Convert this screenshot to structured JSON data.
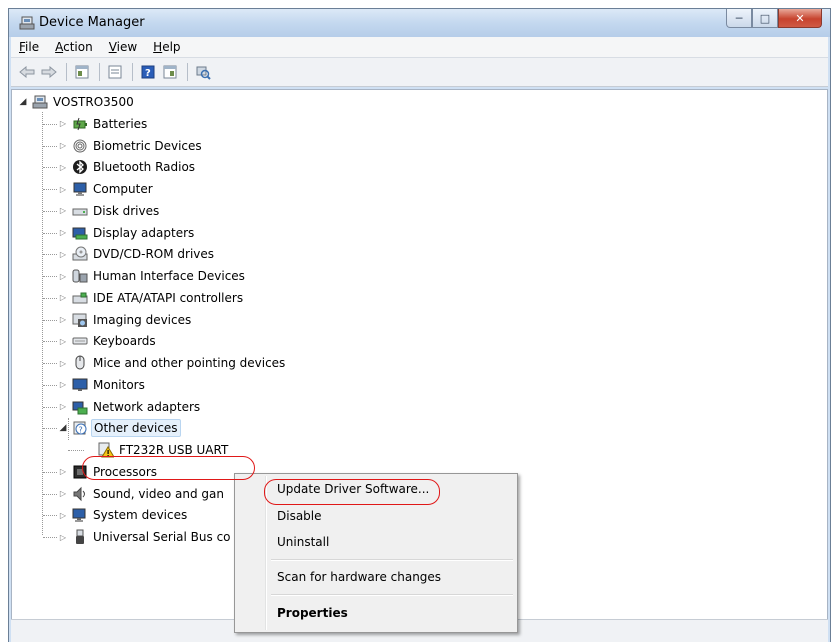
{
  "window": {
    "title": "Device Manager"
  },
  "menu": [
    {
      "label": "File",
      "key": "F",
      "rest": "ile"
    },
    {
      "label": "Action",
      "key": "A",
      "rest": "ction"
    },
    {
      "label": "View",
      "key": "V",
      "rest": "iew"
    },
    {
      "label": "Help",
      "key": "H",
      "rest": "elp"
    }
  ],
  "toolbar": {
    "icons": [
      "back-icon",
      "forward-icon",
      "properties-pane-icon",
      "view-icon",
      "help-icon",
      "console-tree-icon",
      "scan-hardware-icon"
    ]
  },
  "tree": {
    "root": "VOSTRO3500",
    "categories": [
      {
        "label": "Batteries",
        "icon": "battery-icon"
      },
      {
        "label": "Biometric Devices",
        "icon": "fingerprint-icon"
      },
      {
        "label": "Bluetooth Radios",
        "icon": "bluetooth-icon"
      },
      {
        "label": "Computer",
        "icon": "computer-icon"
      },
      {
        "label": "Disk drives",
        "icon": "disk-drive-icon"
      },
      {
        "label": "Display adapters",
        "icon": "display-adapter-icon"
      },
      {
        "label": "DVD/CD-ROM drives",
        "icon": "dvd-drive-icon"
      },
      {
        "label": "Human Interface Devices",
        "icon": "hid-icon"
      },
      {
        "label": "IDE ATA/ATAPI controllers",
        "icon": "ide-controller-icon"
      },
      {
        "label": "Imaging devices",
        "icon": "camera-icon"
      },
      {
        "label": "Keyboards",
        "icon": "keyboard-icon"
      },
      {
        "label": "Mice and other pointing devices",
        "icon": "mouse-icon"
      },
      {
        "label": "Monitors",
        "icon": "monitor-icon"
      },
      {
        "label": "Network adapters",
        "icon": "network-adapter-icon"
      },
      {
        "label": "Other devices",
        "icon": "unknown-device-icon"
      },
      {
        "label": "FT232R USB UART",
        "icon": "warning-device-icon"
      },
      {
        "label": "Processors",
        "icon": "processor-icon"
      },
      {
        "label": "Sound, video and gan",
        "icon": "speaker-icon"
      },
      {
        "label": "System devices",
        "icon": "system-device-icon"
      },
      {
        "label": "Universal Serial Bus co",
        "icon": "usb-icon"
      }
    ]
  },
  "context_menu": {
    "items": [
      "Update Driver Software...",
      "Disable",
      "Uninstall",
      "Scan for hardware changes",
      "Properties"
    ]
  },
  "colors": {
    "annotation": "#e01818",
    "selection": "#e5f0fb",
    "titlebar": "#c4d8ef"
  }
}
